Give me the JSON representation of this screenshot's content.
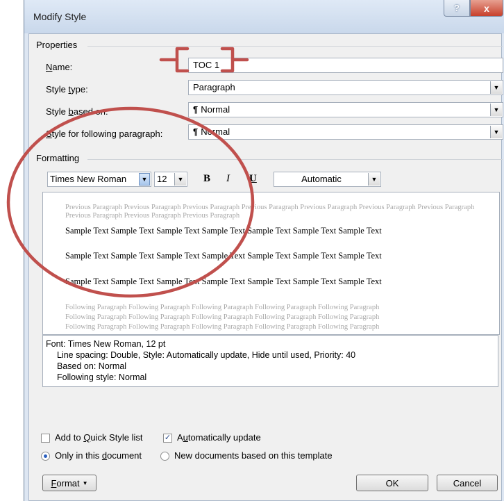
{
  "dialog": {
    "title": "Modify Style",
    "help_glyph": "?",
    "close_glyph": "x"
  },
  "properties": {
    "group_label": "Properties",
    "name_label": "Name:",
    "name_value": "TOC 1",
    "style_type_label": "Style type:",
    "style_type_value": "Paragraph",
    "based_on_label": "Style based on:",
    "based_on_value": "Normal",
    "following_label": "Style for following paragraph:",
    "following_value": "Normal"
  },
  "formatting": {
    "group_label": "Formatting",
    "font": "Times New Roman",
    "size": "12",
    "bold": "B",
    "italic": "I",
    "underline": "U",
    "color": "Automatic"
  },
  "preview": {
    "previous": "Previous Paragraph Previous Paragraph Previous Paragraph Previous Paragraph Previous Paragraph Previous Paragraph Previous Paragraph Previous Paragraph Previous Paragraph Previous Paragraph",
    "sample_line": "Sample Text Sample Text Sample Text Sample Text Sample Text Sample Text Sample Text",
    "following_line": "Following Paragraph Following Paragraph Following Paragraph Following Paragraph Following Paragraph"
  },
  "description": {
    "line1": "Font: Times New Roman, 12 pt",
    "line2": "Line spacing:  Double, Style: Automatically update, Hide until used, Priority: 40",
    "line3": "Based on: Normal",
    "line4": "Following style: Normal"
  },
  "options": {
    "add_quick_style": "Add to Quick Style list",
    "add_quick_style_checked": false,
    "auto_update": "Automatically update",
    "auto_update_checked": true,
    "only_this_doc": "Only in this document",
    "new_docs": "New documents based on this template",
    "selected_scope": "only_this_doc"
  },
  "buttons": {
    "format": "Format",
    "ok": "OK",
    "cancel": "Cancel"
  },
  "colors": {
    "annotation": "#c0504d",
    "window_frame": "#dde6f2",
    "close_button": "#c7402b"
  }
}
